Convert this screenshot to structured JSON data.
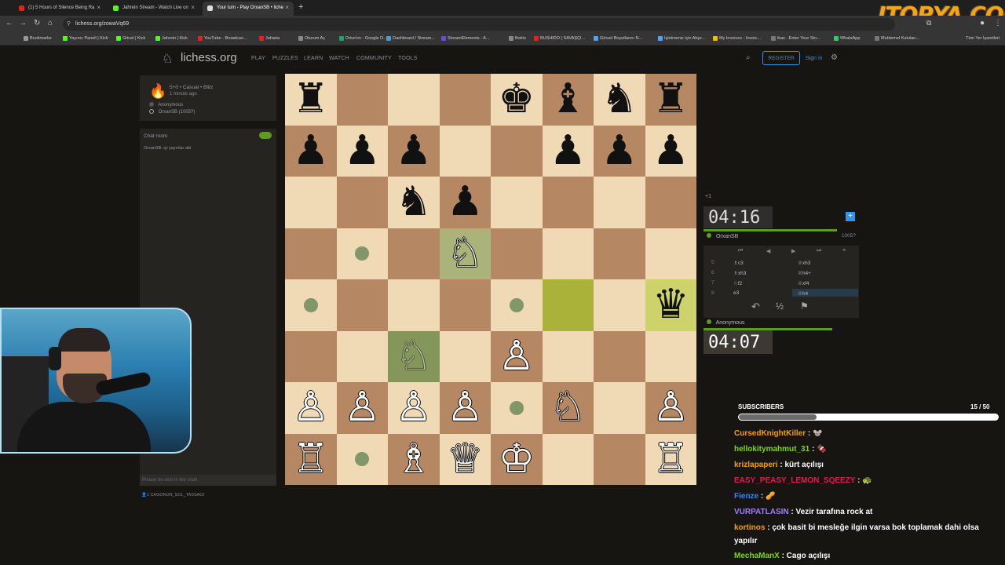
{
  "browser": {
    "tabs": [
      {
        "label": "(1) 5 Hours of Silence Being Ra",
        "icon_color": "#e62117"
      },
      {
        "label": "Jahrein Stream - Watch Live on",
        "icon_color": "#53fc18"
      },
      {
        "label": "Your turn - Play OrxanSB • liche",
        "icon_color": "#dddddd"
      }
    ],
    "new_tab": "+",
    "url": "lichess.org/zowaVq69",
    "bookmarks": [
      "Bookmarks",
      "Yayıncı Paneli | Kick",
      "Gitcat | Kick",
      "Jahrein | Kick",
      "YouTube - Broadcas...",
      "Jaharia",
      "Oturum Aç",
      "Drive'ım - Google D...",
      "Dashboard / Stream...",
      "StreamElements - A...",
      "Botrix",
      "BUSHIDO | SAVAŞÇI...",
      "Görsel Boyutlarını N...",
      "İşletmeniz için Alışv...",
      "My Invoices - Invoic...",
      "ikas - Enter Your Sto...",
      "WhatsApp",
      "Muhtemel Kutuları..."
    ],
    "bookmarks_right": "Tüm Yer İşaretleri"
  },
  "watermark": "ITOPYA.COM",
  "lichess": {
    "brand": "lichess.org",
    "nav": [
      "PLAY",
      "PUZZLES",
      "LEARN",
      "WATCH",
      "COMMUNITY",
      "TOOLS"
    ],
    "register": "REGISTER",
    "signin": "Sign in"
  },
  "game_info": {
    "mode": "5+0 • Casual • Blitz",
    "time_ago": "1 minute ago",
    "player_black": "Anonymous",
    "player_white": "OrxanSB (1005?)"
  },
  "chat": {
    "title": "Chat room",
    "message": "OrxanSB: iyi yayınlar abi",
    "placeholder": "Please be nice in the chat!",
    "spectators": "CAGONUN_SOL_TASSAGI"
  },
  "board": {
    "pieces": [
      {
        "sq": "a8",
        "glyph": "♜",
        "color": "b"
      },
      {
        "sq": "e8",
        "glyph": "♚",
        "color": "b"
      },
      {
        "sq": "f8",
        "glyph": "♝",
        "color": "b"
      },
      {
        "sq": "g8",
        "glyph": "♞",
        "color": "b"
      },
      {
        "sq": "h8",
        "glyph": "♜",
        "color": "b"
      },
      {
        "sq": "a7",
        "glyph": "♟",
        "color": "b"
      },
      {
        "sq": "b7",
        "glyph": "♟",
        "color": "b"
      },
      {
        "sq": "c7",
        "glyph": "♟",
        "color": "b"
      },
      {
        "sq": "f7",
        "glyph": "♟",
        "color": "b"
      },
      {
        "sq": "g7",
        "glyph": "♟",
        "color": "b"
      },
      {
        "sq": "h7",
        "glyph": "♟",
        "color": "b"
      },
      {
        "sq": "c6",
        "glyph": "♞",
        "color": "b"
      },
      {
        "sq": "d6",
        "glyph": "♟",
        "color": "b"
      },
      {
        "sq": "d5",
        "glyph": "♘",
        "color": "w"
      },
      {
        "sq": "h4",
        "glyph": "♛",
        "color": "b"
      },
      {
        "sq": "c3",
        "glyph": "♘",
        "color": "g"
      },
      {
        "sq": "e3",
        "glyph": "♙",
        "color": "w"
      },
      {
        "sq": "a2",
        "glyph": "♙",
        "color": "w"
      },
      {
        "sq": "b2",
        "glyph": "♙",
        "color": "w"
      },
      {
        "sq": "c2",
        "glyph": "♙",
        "color": "w"
      },
      {
        "sq": "d2",
        "glyph": "♙",
        "color": "w"
      },
      {
        "sq": "f2",
        "glyph": "♘",
        "color": "w"
      },
      {
        "sq": "h2",
        "glyph": "♙",
        "color": "w"
      },
      {
        "sq": "a1",
        "glyph": "♖",
        "color": "w"
      },
      {
        "sq": "c1",
        "glyph": "♗",
        "color": "w"
      },
      {
        "sq": "d1",
        "glyph": "♕",
        "color": "w"
      },
      {
        "sq": "e1",
        "glyph": "♔",
        "color": "w"
      },
      {
        "sq": "h1",
        "glyph": "♖",
        "color": "w"
      }
    ],
    "highlights": [
      {
        "sq": "d5",
        "color": "#aab37a"
      },
      {
        "sq": "c3",
        "color": "#84965a"
      },
      {
        "sq": "f4",
        "color": "#aab23a"
      },
      {
        "sq": "h4",
        "color": "#cdd26a"
      }
    ],
    "move_dots": [
      "b5",
      "a4",
      "e4",
      "e2",
      "b1"
    ]
  },
  "clocks": {
    "top": "04:16",
    "top_player": "OrxanSB",
    "top_rating": "1005?",
    "spectator_count": "+1",
    "bottom": "04:07",
    "bottom_player": "Anonymous"
  },
  "moves": [
    {
      "n": "5",
      "w": "♗c3",
      "b": "♕xh3"
    },
    {
      "n": "6",
      "w": "♗xh3",
      "b": "♕h4+"
    },
    {
      "n": "7",
      "w": "♘f2",
      "b": "♕xf4"
    },
    {
      "n": "8",
      "w": "e3",
      "b": "♕h4"
    }
  ],
  "move_controls": [
    "⏮",
    "◀",
    "▶",
    "⏭",
    "≡"
  ],
  "game_actions": [
    "↶",
    "½",
    "⚑"
  ],
  "subs": {
    "label": "SUBSCRIBERS",
    "count": "15 / 50",
    "progress": 0.3
  },
  "stream_chat": [
    {
      "user": "CursedKnightKiller",
      "color": "#f0a000",
      "text": ": 🐭"
    },
    {
      "user": "hellokitymahmut_31",
      "color": "#7ed321",
      "text": ": 🍫"
    },
    {
      "user": "krizlapaperi",
      "color": "#f0a000",
      "text": ": kürt açılışı"
    },
    {
      "user": "EASY_PEASY_LEMON_SQEEZY",
      "color": "#e8174f",
      "text": ": 🐢"
    },
    {
      "user": "Fienze",
      "color": "#3b82f6",
      "text": ": 🥜"
    },
    {
      "user": "VURPATLASIN",
      "color": "#a67cff",
      "text": ": Vezir tarafına rock at"
    },
    {
      "user": "kortinos",
      "color": "#f0a000",
      "text": ": çok basit bi mesleğe ilgin varsa bok toplamak dahi olsa yapılır"
    },
    {
      "user": "MechaManX",
      "color": "#7ed321",
      "text": ": Cago açılışı"
    }
  ]
}
